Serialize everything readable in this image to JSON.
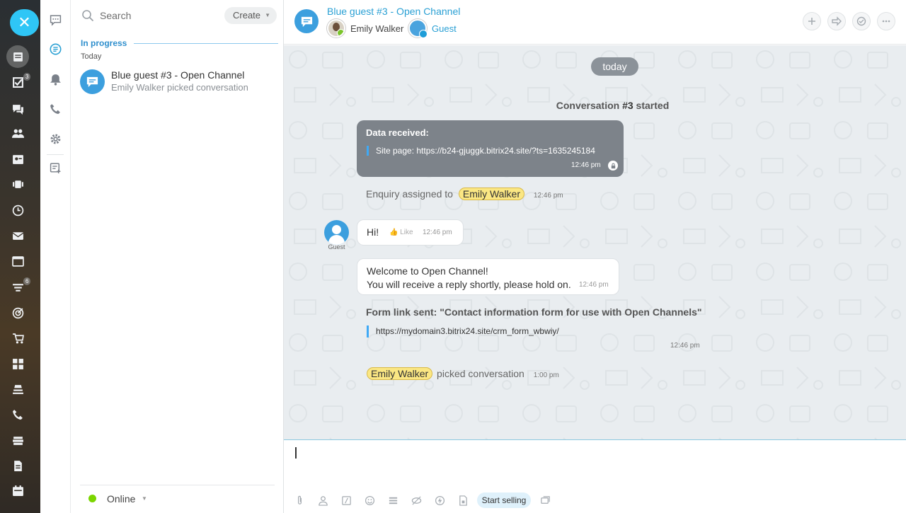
{
  "rail_left": {
    "close_label": "✕",
    "items": [
      {
        "icon": "feed-icon"
      },
      {
        "icon": "tasks-icon",
        "count": "3"
      },
      {
        "icon": "chat-icon"
      },
      {
        "icon": "workgroups-icon"
      },
      {
        "icon": "contacts-icon"
      },
      {
        "icon": "video-icon"
      },
      {
        "icon": "time-icon"
      },
      {
        "icon": "mail-icon"
      },
      {
        "icon": "sites-icon"
      },
      {
        "icon": "filter-icon",
        "count": "6"
      },
      {
        "icon": "marketing-icon"
      },
      {
        "icon": "cart-icon"
      },
      {
        "icon": "apps-icon"
      },
      {
        "icon": "store-icon"
      },
      {
        "icon": "phone-icon"
      },
      {
        "icon": "inventory-icon"
      },
      {
        "icon": "document-icon"
      },
      {
        "icon": "calendar-icon"
      }
    ]
  },
  "rail_secondary": {
    "items": [
      "chats-icon",
      "open-lines-icon",
      "notifications-icon",
      "calls-icon",
      "settings-icon",
      "new-chat-icon"
    ]
  },
  "recent": {
    "search_placeholder": "Search",
    "create_label": "Create",
    "section_title": "In progress",
    "date_label": "Today",
    "items": [
      {
        "title": "Blue guest #3 - Open Channel",
        "subtitle": "Emily Walker picked conversation"
      }
    ],
    "status": "Online"
  },
  "header": {
    "title": "Blue guest #3 - Open Channel",
    "user1": "Emily Walker",
    "user2": "Guest",
    "actions": [
      "plus-icon",
      "transfer-icon",
      "finish-icon",
      "more-icon"
    ]
  },
  "messages": {
    "date_pill": "today",
    "conv_prefix": "Conversation ",
    "conv_number": "#3",
    "conv_suffix": " started",
    "data_received": {
      "title": "Data received:",
      "line": "Site page: https://b24-gjuggk.bitrix24.site/?ts=1635245184",
      "time": "12:46 pm"
    },
    "assigned": {
      "text": "Enquiry assigned to",
      "user": "Emily Walker",
      "time": "12:46 pm"
    },
    "guest_label": "Guest",
    "hi": {
      "text": "Hi!",
      "like": "Like",
      "time": "12:46 pm"
    },
    "welcome": {
      "line1": "Welcome to Open Channel!",
      "line2": "You will receive a reply shortly, please hold on.",
      "time": "12:46 pm"
    },
    "form": {
      "title": "Form link sent: \"Contact information form for use with Open Channels\"",
      "link": "https://mydomain3.bitrix24.site/crm_form_wbwiy/",
      "time": "12:46 pm"
    },
    "picked": {
      "user": "Emily Walker",
      "text": "picked conversation",
      "time": "1:00 pm"
    }
  },
  "composer": {
    "tools": [
      "attach-icon",
      "user-icon",
      "quick-answer-icon",
      "smile-icon",
      "form-icon",
      "hide-icon",
      "lightning-icon",
      "file-icon"
    ],
    "start_selling": "Start selling",
    "last_tool": "copy-icon"
  },
  "colors": {
    "accent": "#2fc6f6",
    "link": "#2aa0d4",
    "highlight": "#fbe783"
  }
}
